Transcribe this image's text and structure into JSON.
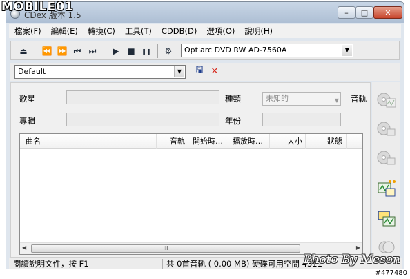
{
  "window": {
    "title": "CDex 版本 1.5",
    "minimize_glyph": "–",
    "maximize_glyph": "□",
    "close_glyph": "✕"
  },
  "menu": [
    {
      "label": "檔案(F)"
    },
    {
      "label": "編輯(E)"
    },
    {
      "label": "轉換(C)"
    },
    {
      "label": "工具(T)"
    },
    {
      "label": "CDDB(D)"
    },
    {
      "label": "選項(O)"
    },
    {
      "label": "說明(H)"
    }
  ],
  "toolbar": {
    "icons": [
      "eject-icon",
      "rewind-icon",
      "fast-forward-icon",
      "previous-track-icon",
      "next-track-icon",
      "play-icon",
      "stop-icon",
      "pause-icon",
      "settings-icon"
    ],
    "glyphs": [
      "⏏",
      "⏪",
      "⏩",
      "⏮",
      "⏭",
      "▶",
      "■",
      "❚❚",
      "⚙"
    ],
    "drive": "Optiarc DVD RW AD-7560A"
  },
  "profile": {
    "selected": "Default",
    "save_glyph": "🖫",
    "delete_glyph": "✕"
  },
  "info": {
    "artist_label": "歌星",
    "album_label": "專輯",
    "genre_label": "種類",
    "genre_value": "未知的",
    "year_label": "年份",
    "track_label": "音軌"
  },
  "track_list": {
    "columns": [
      "曲名",
      "音軌",
      "開始時…",
      "播放時…",
      "大小",
      "狀態"
    ],
    "rows": [],
    "scroll_grip": "III"
  },
  "side_buttons": [
    "rip-to-wav-icon",
    "rip-to-mp3-icon",
    "rip-range-icon",
    "convert-wav-to-mp3-icon",
    "convert-mp3-to-wav-icon",
    "play-audio-icon"
  ],
  "status": {
    "help": "閱讀說明文件，按 F1",
    "summary": "共 0首音軌 ( 0.00 MB) 硬碟可用空間  4311"
  },
  "watermarks": {
    "logo": "MOBILE01",
    "photo_by": "Photo By Meson",
    "id": "#477480"
  },
  "colors": {
    "delete_red": "#d62a1e",
    "save_blue": "#1c3c8c"
  }
}
